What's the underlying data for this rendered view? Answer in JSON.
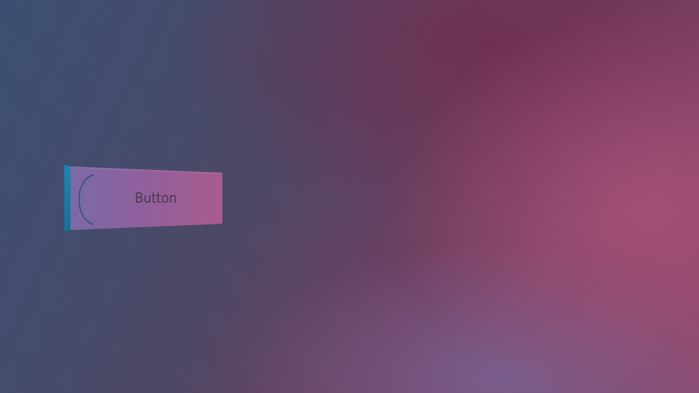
{
  "button": {
    "label": "Button"
  },
  "colors": {
    "button_left": "#7b6aa4",
    "button_right": "#a85c8f",
    "button_edge": "#1a7aa6"
  }
}
